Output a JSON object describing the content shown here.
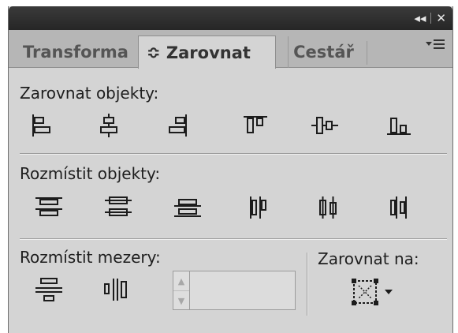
{
  "titlebar": {
    "collapse_glyph": "◂◂",
    "close_glyph": "✕"
  },
  "tabs": [
    {
      "label": "Transforma"
    },
    {
      "label": "≎ Zarovnat"
    },
    {
      "label": "Cestář"
    }
  ],
  "align_objects": {
    "label": "Zarovnat objekty:"
  },
  "distribute_objects": {
    "label": "Rozmístit objekty:"
  },
  "distribute_spacing": {
    "label": "Rozmístit mezery:",
    "value": ""
  },
  "align_to": {
    "label": "Zarovnat na:"
  },
  "colors": {
    "icon": "#1c1c1c",
    "panel_bg": "#d4d4d4",
    "titlebar": "#2e2e2e"
  }
}
